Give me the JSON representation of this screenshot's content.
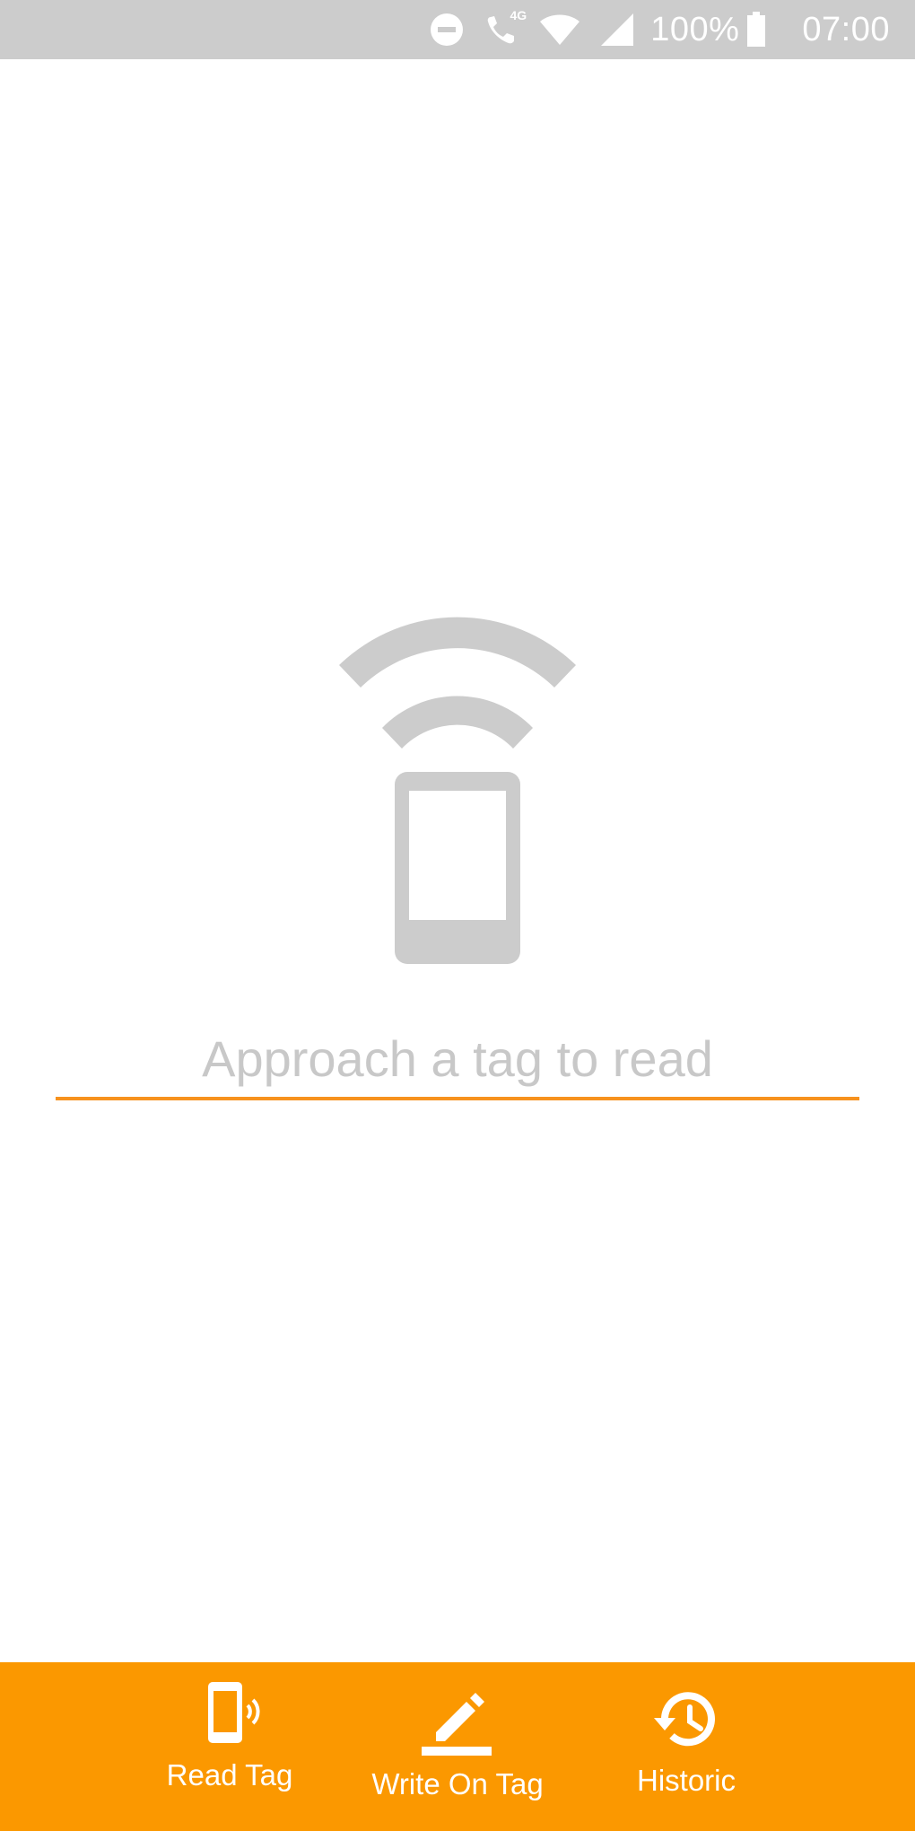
{
  "status_bar": {
    "icons": [
      "do-not-disturb-icon",
      "volte-call-icon",
      "wifi-icon",
      "signal-icon",
      "battery-icon"
    ],
    "call_badge": "4G",
    "battery": "100%",
    "time": "07:00"
  },
  "main": {
    "icon": "nfc-phone-icon",
    "prompt": "Approach a tag to read"
  },
  "bottom_nav": {
    "items": [
      {
        "label": "Read Tag",
        "icon": "phone-read-icon"
      },
      {
        "label": "Write On Tag",
        "icon": "pencil-icon"
      },
      {
        "label": "Historic",
        "icon": "history-icon"
      }
    ]
  },
  "colors": {
    "status_bar": "#cccccc",
    "accent": "#f7921e",
    "nav_background": "#fb9800",
    "icon_gray": "#cccccc",
    "placeholder_gray": "#c8c8c8"
  }
}
